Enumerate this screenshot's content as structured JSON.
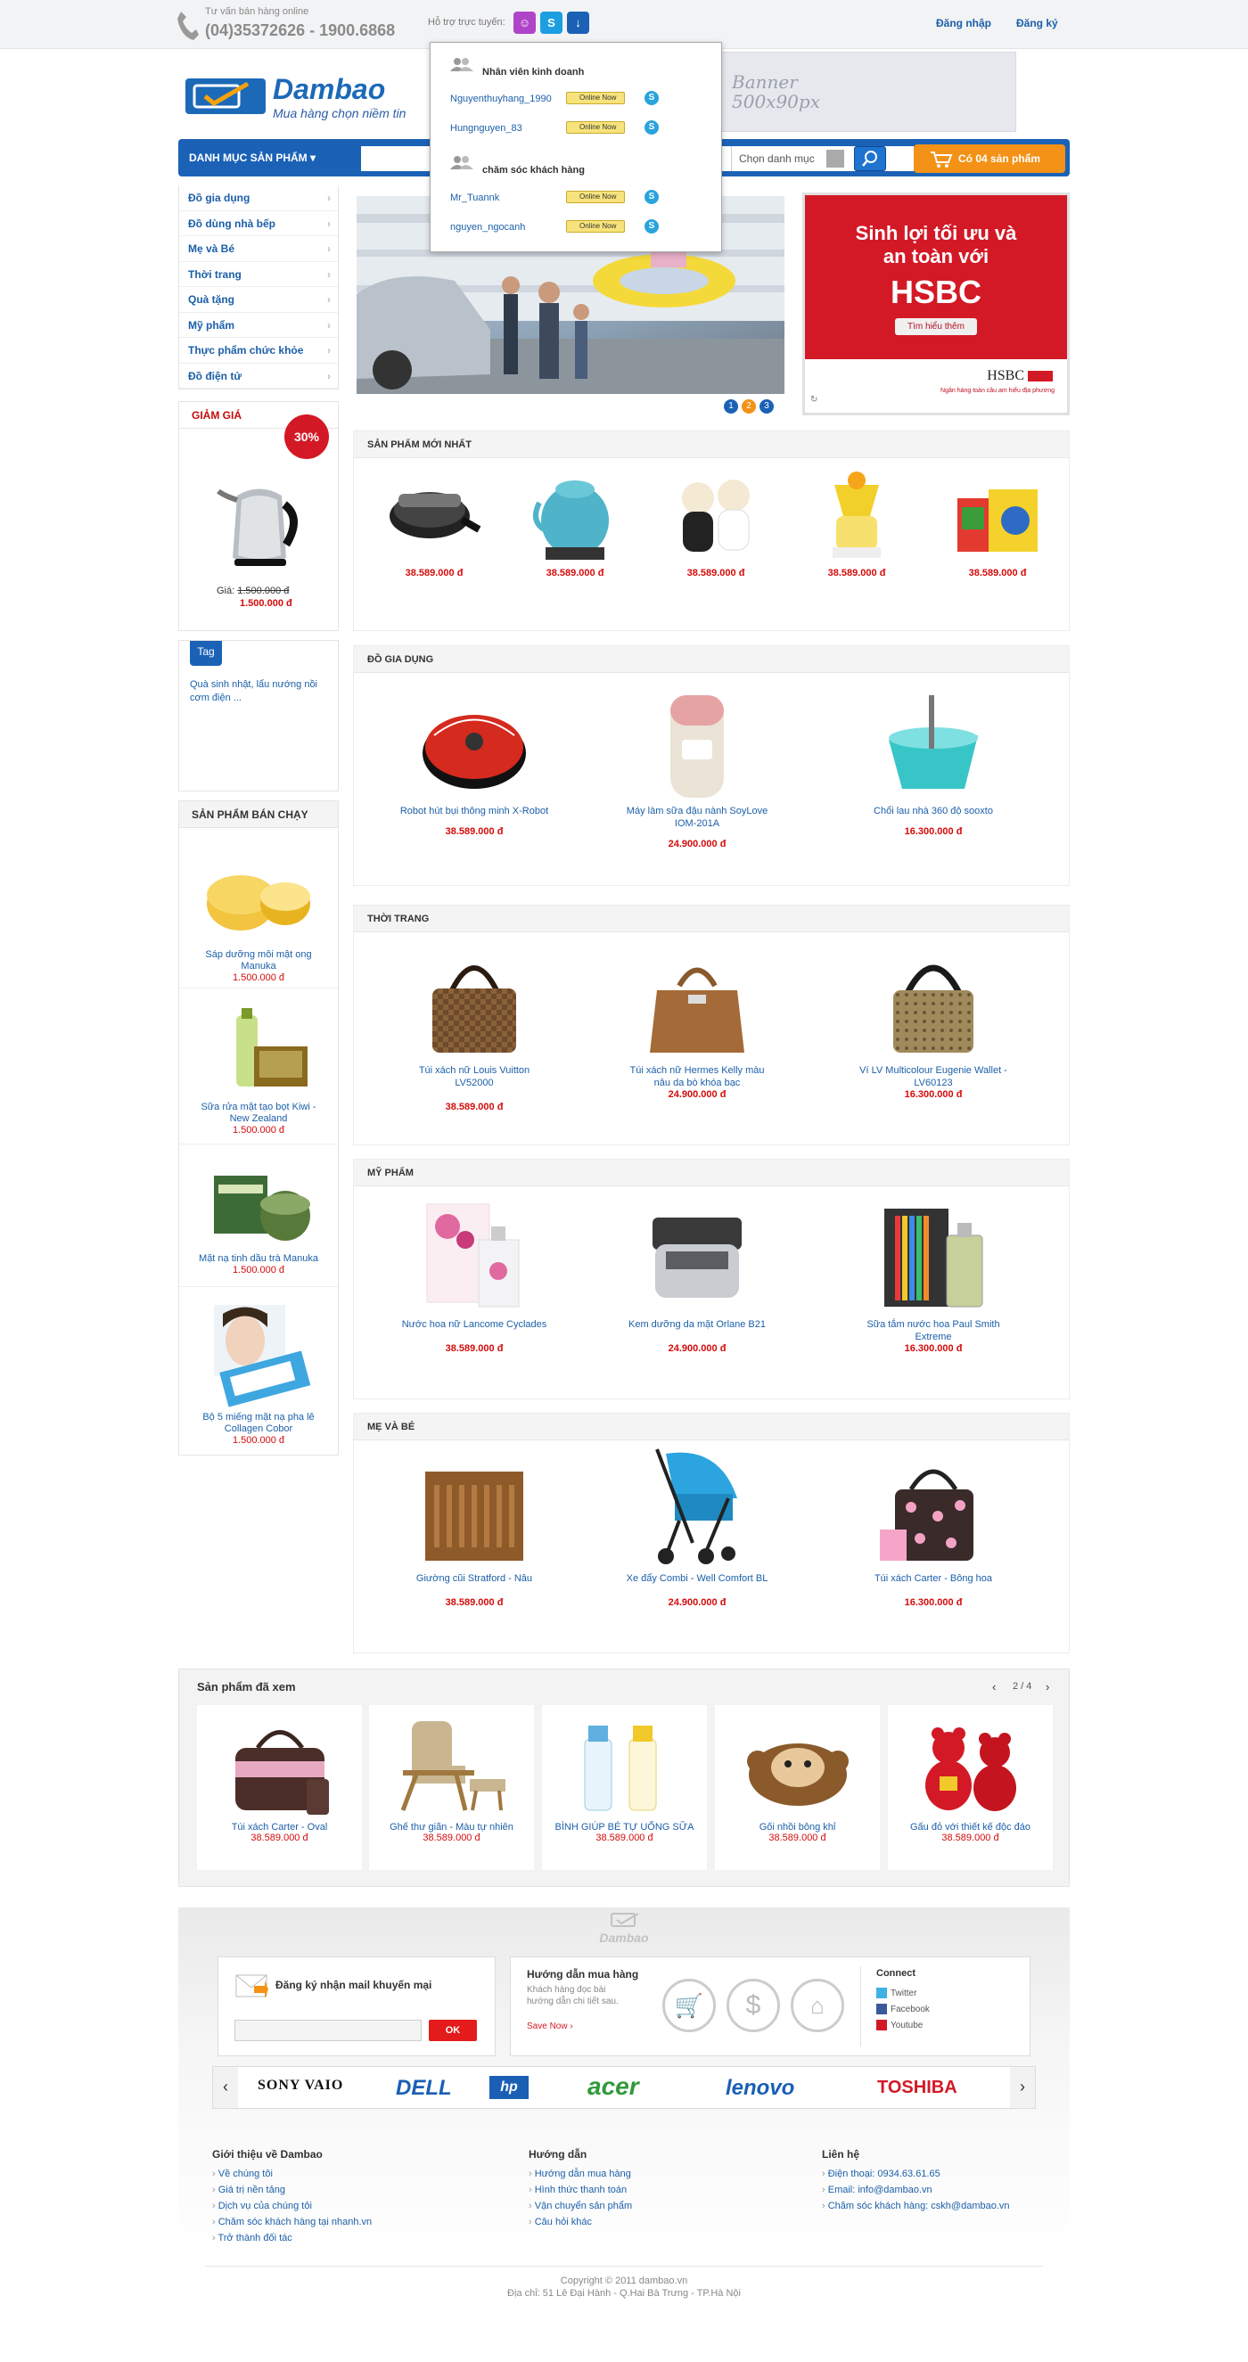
{
  "topbar": {
    "hotline_caption": "Tư vấn bán hàng online",
    "hotline_number": "(04)35372626 - 1900.6868",
    "support_label": "Hỗ trợ trực tuyến:",
    "login": "Đăng nhập",
    "register": "Đăng ký"
  },
  "support_popup": {
    "groups": [
      {
        "title": "Nhân viên kinh doanh",
        "agents": [
          {
            "name": "Nguyenthuyhang_1990",
            "status": "Online Now"
          },
          {
            "name": "Hungnguyen_83",
            "status": "Online Now"
          }
        ]
      },
      {
        "title": "chăm sóc khách hàng",
        "agents": [
          {
            "name": "Mr_Tuannk",
            "status": "Online Now"
          },
          {
            "name": "nguyen_ngocanh",
            "status": "Online Now"
          }
        ]
      }
    ]
  },
  "logo": {
    "name": "Dambao",
    "slogan": "Mua hàng chọn niềm tin"
  },
  "banner": {
    "line1": "Banner",
    "line2": "500x90px"
  },
  "nav": {
    "category_menu": "DANH MỤC SẢN PHẨM",
    "search_placeholder": "",
    "category_select": "Chọn danh mục",
    "cart": "Có 04 sản phẩm"
  },
  "sidebar": {
    "categories": [
      "Đồ gia dụng",
      "Đồ dùng nhà bếp",
      "Mẹ và Bé",
      "Thời trang",
      "Quà tặng",
      "Mỹ phẩm",
      "Thực phẩm chức khỏe",
      "Đồ điện tử"
    ],
    "discount": {
      "title": "GIẢM GIÁ",
      "badge": "30%",
      "price_label": "Giá:",
      "old_price": "1.500.000 đ",
      "new_price": "1.500.000 đ"
    },
    "tag": {
      "label": "Tag",
      "text": "Quà sinh nhật, lẩu nướng nồi cơm điện ..."
    },
    "bestsellers": {
      "title": "SẢN PHẨM BÁN CHẠY",
      "items": [
        {
          "name": "Sáp dưỡng môi mật ong Manuka",
          "price": "1.500.000 đ"
        },
        {
          "name": "Sữa rửa mặt tạo bọt Kiwi - New Zealand",
          "price": "1.500.000 đ"
        },
        {
          "name": "Mặt nạ tinh dầu trà Manuka",
          "price": "1.500.000 đ"
        },
        {
          "name": "Bộ 5 miếng mặt nạ pha lê Collagen Cobor",
          "price": "1.500.000 đ"
        }
      ]
    }
  },
  "slideshow": {
    "dots": [
      "1",
      "2",
      "3"
    ]
  },
  "hsbc": {
    "headline": "Sinh lợi tối ưu và an toàn với",
    "brand": "HSBC",
    "button": "Tìm hiểu thêm",
    "logo": "HSBC",
    "tagline": "Ngân hàng toàn cầu am hiểu địa phương"
  },
  "sections": [
    {
      "title": "SẢN PHẨM MỚI NHẤT",
      "products": [
        {
          "name": "",
          "price": "38.589.000 đ"
        },
        {
          "name": "",
          "price": "38.589.000 đ"
        },
        {
          "name": "",
          "price": "38.589.000 đ"
        },
        {
          "name": "",
          "price": "38.589.000 đ"
        },
        {
          "name": "",
          "price": "38.589.000 đ"
        }
      ]
    },
    {
      "title": "ĐỒ GIA DỤNG",
      "products": [
        {
          "name": "Robot hút bụi thông minh X-Robot",
          "price": "38.589.000 đ"
        },
        {
          "name": "Máy làm sữa đậu nành SoyLove IOM-201A",
          "price": "24.900.000 đ"
        },
        {
          "name": "Chổi lau nhà 360 độ sooxto",
          "price": "16.300.000 đ"
        }
      ]
    },
    {
      "title": "THỜI TRANG",
      "products": [
        {
          "name": "Túi xách nữ Louis Vuitton LV52000",
          "price": "38.589.000 đ"
        },
        {
          "name": "Túi xách nữ Hermes Kelly màu nâu da bò khóa bạc",
          "price": "24.900.000 đ"
        },
        {
          "name": "Ví LV Multicolour Eugenie Wallet - LV60123",
          "price": "16.300.000 đ"
        }
      ]
    },
    {
      "title": "MỸ PHẨM",
      "products": [
        {
          "name": "Nước hoa nữ Lancome Cyclades",
          "price": "38.589.000 đ"
        },
        {
          "name": "Kem dưỡng da mặt Orlane B21",
          "price": "24.900.000 đ"
        },
        {
          "name": "Sữa tắm nước hoa Paul Smith Extreme",
          "price": "16.300.000 đ"
        }
      ]
    },
    {
      "title": "MẸ VÀ BÉ",
      "products": [
        {
          "name": "Giường cũi Stratford - Nâu",
          "price": "38.589.000 đ"
        },
        {
          "name": "Xe đẩy Combi - Well Comfort BL",
          "price": "24.900.000 đ"
        },
        {
          "name": "Túi xách Carter - Bông hoa",
          "price": "16.300.000 đ"
        }
      ]
    }
  ],
  "viewed": {
    "title": "Sản phẩm đã xem",
    "pager": "2 / 4",
    "items": [
      {
        "name": "Túi xách Carter - Oval",
        "price": "38.589.000 đ"
      },
      {
        "name": "Ghế thư giãn - Màu tự nhiên",
        "price": "38.589.000 đ"
      },
      {
        "name": "BÌNH GIÚP BÉ TỰ UỐNG SỮA",
        "price": "38.589.000 đ"
      },
      {
        "name": "Gối nhồi bông khỉ",
        "price": "38.589.000 đ"
      },
      {
        "name": "Gấu đỏ với thiết kế độc đáo",
        "price": "38.589.000 đ"
      }
    ]
  },
  "footer": {
    "logo": "Dambao",
    "newsletter": {
      "title": "Đăng ký nhận mail khuyến mại",
      "button": "OK"
    },
    "guide": {
      "title": "Hướng dẫn mua hàng",
      "text": "Khách hàng đọc bài hướng dẫn chi tiết sau.",
      "link": "Save Now ›"
    },
    "connect": {
      "title": "Connect",
      "links": [
        "Twitter",
        "Facebook",
        "Youtube"
      ]
    },
    "brands": [
      "SONY VAIO",
      "DELL",
      "hp",
      "acer",
      "lenovo",
      "TOSHIBA"
    ],
    "columns": [
      {
        "title": "Giới thiệu về Dambao",
        "links": [
          "Về chúng tôi",
          "Giá trị nền tảng",
          "Dịch vụ của chúng tôi",
          "Chăm sóc khách hàng tại nhanh.vn",
          "Trở thành đối tác"
        ]
      },
      {
        "title": "Hướng dẫn",
        "links": [
          "Hướng dẫn mua hàng",
          "Hình thức thanh toán",
          "Vận chuyển sản phẩm",
          "Câu hỏi khác"
        ]
      },
      {
        "title": "Liên hệ",
        "links": [
          "Điện thoại: 0934.63.61.65",
          "Email: info@dambao.vn",
          "Chăm sóc khách hàng: cskh@dambao.vn"
        ]
      }
    ],
    "copyright": "Copyright © 2011 dambao.vn",
    "address": "Địa chỉ: 51 Lê Đại Hành - Q.Hai Bà Trưng - TP.Hà Nội"
  },
  "colors": {
    "brand_blue": "#1b62b7",
    "price_red": "#d40b0b",
    "cart_orange": "#f39216"
  }
}
